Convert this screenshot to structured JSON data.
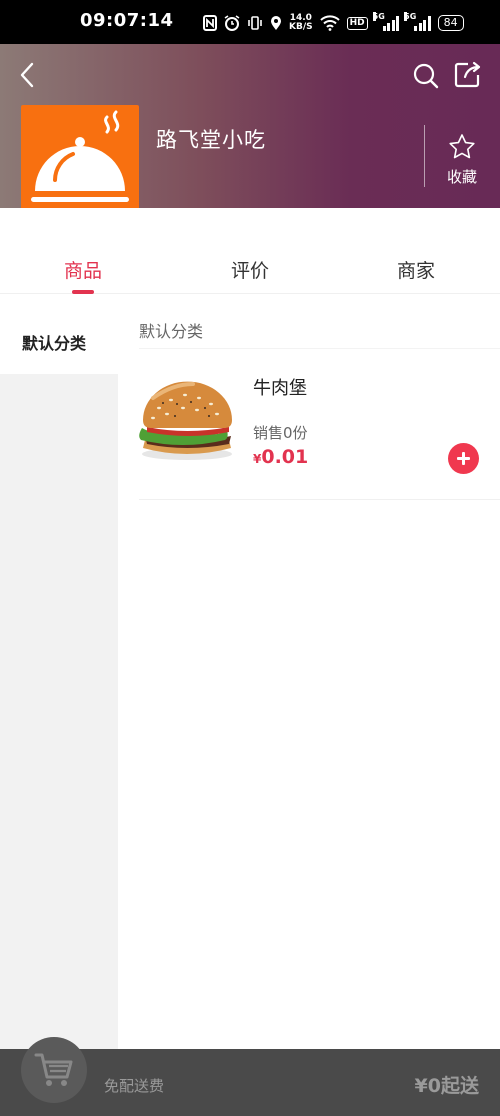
{
  "status_bar": {
    "time": "09:07:14",
    "net_speed_top": "14.0",
    "net_speed_bottom": "KB/S",
    "hd_label": "HD",
    "sim1_label": "5G",
    "sim2_label": "5G",
    "battery": "84"
  },
  "header": {
    "shop_name": "路飞堂小吃",
    "favorite_label": "收藏",
    "gradient_colors": [
      "#8c7a76",
      "#682a56"
    ]
  },
  "tabs": [
    {
      "label": "商品",
      "active": true
    },
    {
      "label": "评价",
      "active": false
    },
    {
      "label": "商家",
      "active": false
    }
  ],
  "sidebar": {
    "categories": [
      {
        "label": "默认分类",
        "selected": true
      }
    ]
  },
  "section": {
    "title": "默认分类"
  },
  "products": [
    {
      "name": "牛肉堡",
      "sales": "销售0份",
      "currency": "¥",
      "price": "0.01",
      "image_icon": "burger-image"
    }
  ],
  "cart_bar": {
    "delivery_text": "免配送费",
    "minimum_text": "¥0起送"
  },
  "colors": {
    "accent": "#e2334f",
    "logo_bg": "#f87010",
    "cart_bar_bg": "#4a4a4a"
  }
}
